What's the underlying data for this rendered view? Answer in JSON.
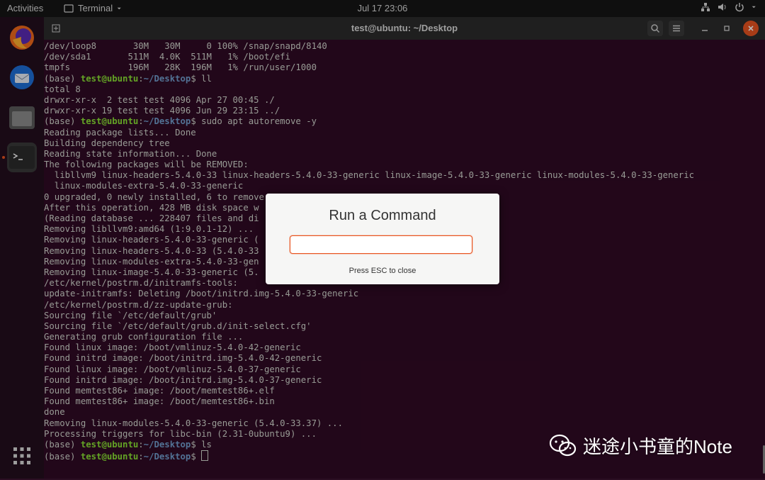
{
  "topbar": {
    "activities": "Activities",
    "app_menu": "Terminal",
    "clock": "Jul 17  23:06"
  },
  "window": {
    "title": "test@ubuntu: ~/Desktop"
  },
  "terminal": {
    "lines": [
      {
        "text": "/dev/loop8       30M   30M     0 100% /snap/snapd/8140"
      },
      {
        "text": "/dev/sda1       511M  4.0K  511M   1% /boot/efi"
      },
      {
        "text": "tmpfs           196M   28K  196M   1% /run/user/1000"
      },
      {
        "prompt": true,
        "cmd": "ll"
      },
      {
        "text": "total 8"
      },
      {
        "text": "drwxr-xr-x  2 test test 4096 Apr 27 00:45 ./"
      },
      {
        "text": "drwxr-xr-x 19 test test 4096 Jun 29 23:15 ../"
      },
      {
        "prompt": true,
        "cmd": "sudo apt autoremove -y"
      },
      {
        "text": "Reading package lists... Done"
      },
      {
        "text": "Building dependency tree"
      },
      {
        "text": "Reading state information... Done"
      },
      {
        "text": "The following packages will be REMOVED:"
      },
      {
        "text": "  libllvm9 linux-headers-5.4.0-33 linux-headers-5.4.0-33-generic linux-image-5.4.0-33-generic linux-modules-5.4.0-33-generic"
      },
      {
        "text": "  linux-modules-extra-5.4.0-33-generic"
      },
      {
        "text": "0 upgraded, 0 newly installed, 6 to remove"
      },
      {
        "text": "After this operation, 428 MB disk space w"
      },
      {
        "text": "(Reading database ... 228407 files and di"
      },
      {
        "text": "Removing libllvm9:amd64 (1:9.0.1-12) ..."
      },
      {
        "text": "Removing linux-headers-5.4.0-33-generic ("
      },
      {
        "text": "Removing linux-headers-5.4.0-33 (5.4.0-33"
      },
      {
        "text": "Removing linux-modules-extra-5.4.0-33-gen"
      },
      {
        "text": "Removing linux-image-5.4.0-33-generic (5."
      },
      {
        "text": "/etc/kernel/postrm.d/initramfs-tools:"
      },
      {
        "text": "update-initramfs: Deleting /boot/initrd.img-5.4.0-33-generic"
      },
      {
        "text": "/etc/kernel/postrm.d/zz-update-grub:"
      },
      {
        "text": "Sourcing file `/etc/default/grub'"
      },
      {
        "text": "Sourcing file `/etc/default/grub.d/init-select.cfg'"
      },
      {
        "text": "Generating grub configuration file ..."
      },
      {
        "text": "Found linux image: /boot/vmlinuz-5.4.0-42-generic"
      },
      {
        "text": "Found initrd image: /boot/initrd.img-5.4.0-42-generic"
      },
      {
        "text": "Found linux image: /boot/vmlinuz-5.4.0-37-generic"
      },
      {
        "text": "Found initrd image: /boot/initrd.img-5.4.0-37-generic"
      },
      {
        "text": "Found memtest86+ image: /boot/memtest86+.elf"
      },
      {
        "text": "Found memtest86+ image: /boot/memtest86+.bin"
      },
      {
        "text": "done"
      },
      {
        "text": "Removing linux-modules-5.4.0-33-generic (5.4.0-33.37) ..."
      },
      {
        "text": "Processing triggers for libc-bin (2.31-0ubuntu9) ..."
      },
      {
        "prompt": true,
        "cmd": "ls"
      },
      {
        "prompt": true,
        "cmd": "",
        "cursor": true
      }
    ],
    "prompt_env": "(base) ",
    "prompt_user": "test@ubuntu",
    "prompt_sep": ":",
    "prompt_path": "~/Desktop",
    "prompt_end": "$ "
  },
  "dialog": {
    "title": "Run a Command",
    "input_value": "",
    "hint": "Press ESC to close"
  },
  "watermark": {
    "text": "迷途小书童的Note"
  },
  "colors": {
    "terminal_bg": "#300a24",
    "prompt_user": "#8ae234",
    "prompt_path": "#729fcf",
    "accent": "#e95420"
  }
}
